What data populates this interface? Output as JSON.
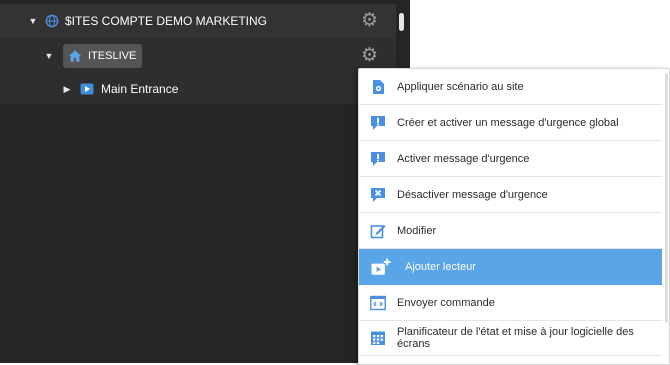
{
  "tree": {
    "root": {
      "label": "$ITES COMPTE DEMO MARKETING",
      "icon": "globe-icon"
    },
    "site": {
      "label": "ITESLIVE",
      "icon": "home-icon"
    },
    "player": {
      "label": "Main Entrance",
      "icon": "player-icon"
    }
  },
  "menu": {
    "items": [
      {
        "label": "Appliquer scénario au site",
        "icon": "scenario-icon"
      },
      {
        "label": "Créer et activer un message d'urgence global",
        "icon": "alert-icon"
      },
      {
        "label": "Activer message d'urgence",
        "icon": "alert-icon"
      },
      {
        "label": "Désactiver message d'urgence",
        "icon": "deactivate-icon"
      },
      {
        "label": "Modifier",
        "icon": "edit-icon"
      },
      {
        "label": "Ajouter lecteur",
        "icon": "add-player-icon",
        "active": true
      },
      {
        "label": "Envoyer commande",
        "icon": "code-icon"
      },
      {
        "label": "Planificateur de l'état et mise à jour logicielle des écrans",
        "icon": "calendar-icon"
      }
    ]
  },
  "colors": {
    "panel_bg": "#252525",
    "row_bg": "#333333",
    "accent_blue": "#4a90e2",
    "active_item": "#5aa5e7"
  }
}
